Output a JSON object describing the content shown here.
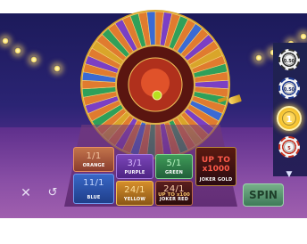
{
  "bets": {
    "orange": {
      "odds": "1/1",
      "label": "ORANGE",
      "color": "#c2734b"
    },
    "purple": {
      "odds": "3/1",
      "label": "PURPLE",
      "color": "#7a45b8"
    },
    "green": {
      "odds": "5/1",
      "label": "GREEN",
      "color": "#3f9b58"
    },
    "blue": {
      "odds": "11/1",
      "label": "BLUE",
      "color": "#3867c6"
    },
    "yellow": {
      "odds": "24/1",
      "label": "YELLOW",
      "color": "#d58e2b"
    },
    "joker_red": {
      "odds": "24/1",
      "odds_sub": "UP TO x100",
      "label": "JOKER RED",
      "color": "#5a1e1e"
    },
    "joker_gold": {
      "odds": "UP TO",
      "odds_sub": "x1000",
      "label": "JOKER GOLD",
      "color": "#5a1a10"
    }
  },
  "chips": [
    {
      "value": "0.50",
      "color": "#2d2d2d"
    },
    {
      "value": "0.50",
      "color": "#1f3a8f"
    },
    {
      "value": "1",
      "color": "#f7c531",
      "selected": true
    },
    {
      "value": "5",
      "color": "#c5301f"
    }
  ],
  "controls": {
    "clear_icon": "✕",
    "undo_icon": "↺",
    "spin_label": "SPIN",
    "chips_toggle_icon": "▼"
  },
  "wheel": {
    "segment_colors": [
      "#e07b2f",
      "#7b3fc4",
      "#e07b2f",
      "#2fa05a",
      "#e07b2f",
      "#3a6ad4",
      "#e07b2f",
      "#7b3fc4",
      "#e07b2f",
      "#d9a52a",
      "#e07b2f",
      "#2fa05a"
    ],
    "rim_color": "#d9a52a",
    "hub_color": "#b0301c"
  }
}
